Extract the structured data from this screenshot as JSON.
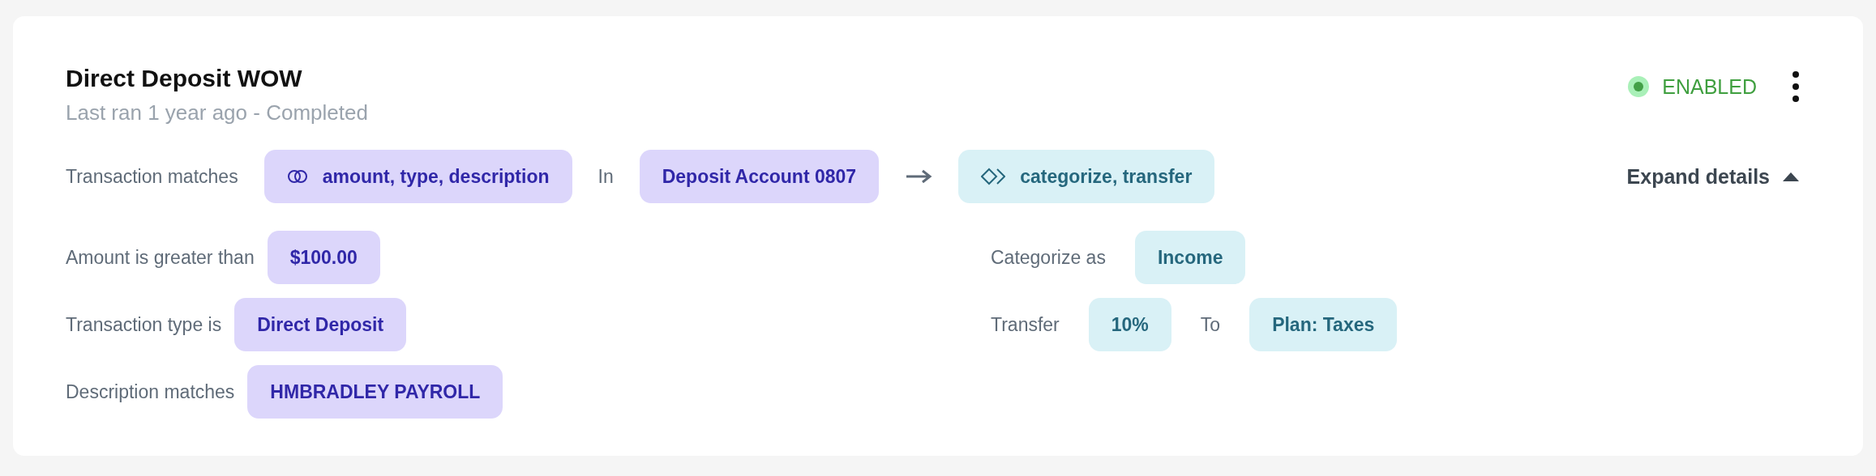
{
  "rule": {
    "title": "Direct Deposit WOW",
    "subtitle": "Last ran 1 year ago - Completed",
    "status": {
      "label": "ENABLED",
      "enabled": true
    },
    "summary": {
      "label": "Transaction matches",
      "conditions": "amount, type, description",
      "in_label": "In",
      "account": "Deposit Account 0807",
      "actions": "categorize, transfer"
    },
    "expand": {
      "label": "Expand details",
      "expanded": true
    },
    "conditions": [
      {
        "label": "Amount is greater than",
        "value": "$100.00"
      },
      {
        "label": "Transaction type is",
        "value": "Direct Deposit"
      },
      {
        "label": "Description matches",
        "value": "HMBRADLEY PAYROLL"
      }
    ],
    "actions": [
      {
        "parts": [
          {
            "kind": "label",
            "text": "Categorize as"
          },
          {
            "kind": "chip",
            "text": "Income"
          }
        ]
      },
      {
        "parts": [
          {
            "kind": "label",
            "text": "Transfer"
          },
          {
            "kind": "chip",
            "text": "10%"
          },
          {
            "kind": "label",
            "text": "To"
          },
          {
            "kind": "chip",
            "text": "Plan: Taxes"
          }
        ]
      }
    ]
  }
}
